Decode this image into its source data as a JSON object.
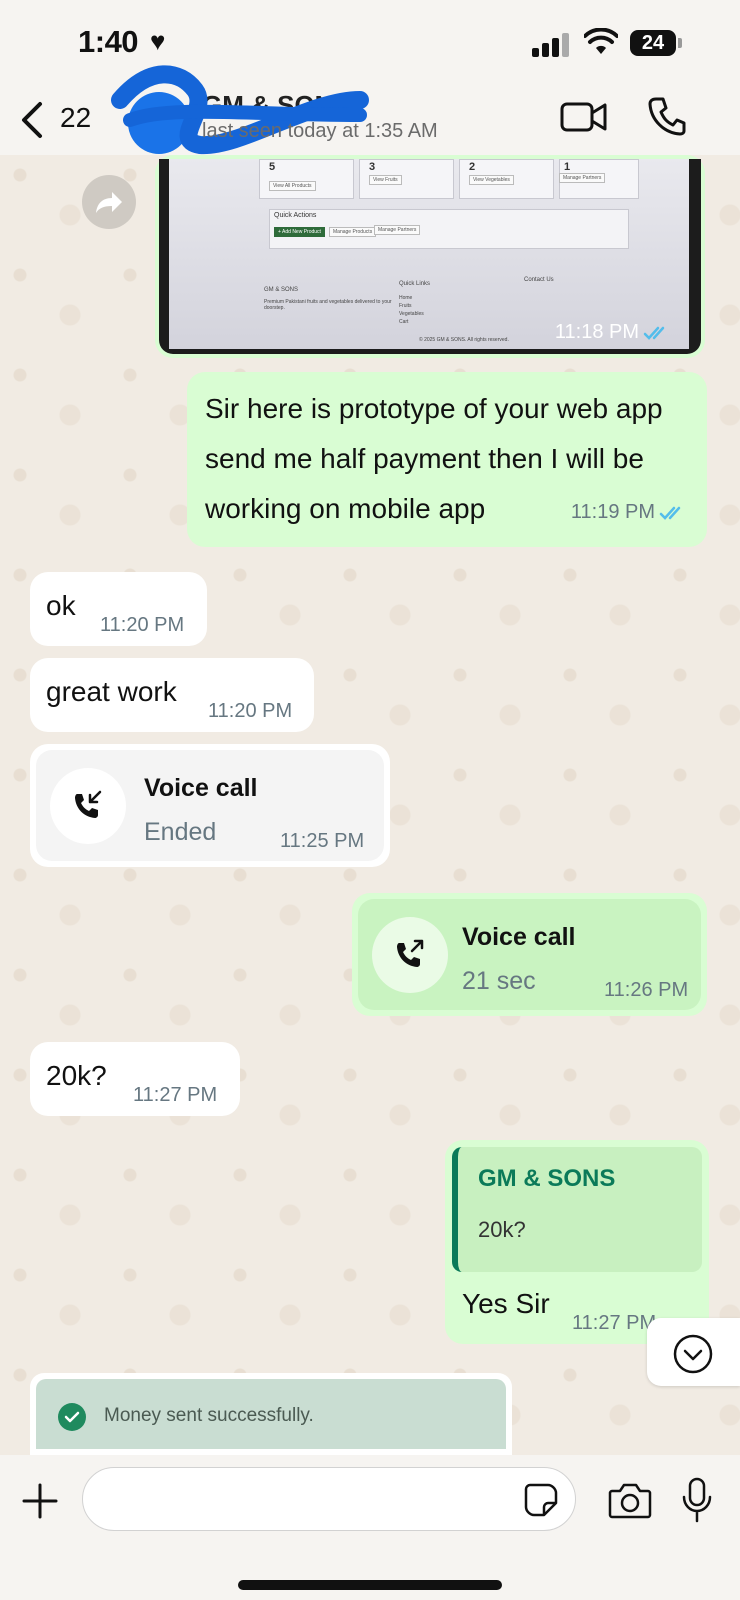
{
  "status_bar": {
    "time": "1:40",
    "battery": "24"
  },
  "header": {
    "unread_count": "22",
    "contact_name": "GM & SONS",
    "last_seen": "last seen today at 1:35 AM",
    "video_icon": "video-camera-icon",
    "call_icon": "phone-icon"
  },
  "messages": {
    "image": {
      "time": "11:18 PM",
      "screen": {
        "stats": [
          "5",
          "3",
          "2",
          "1"
        ],
        "stat_buttons": [
          "View All Products",
          "View Fruits",
          "View Vegetables",
          "Manage Partners"
        ],
        "quick_actions_title": "Quick Actions",
        "actions": [
          "+ Add New Product",
          "Manage Products",
          "Manage Partners"
        ],
        "footer_brand": "GM & SONS",
        "footer_tagline": "Premium Pakistani fruits and vegetables delivered to your doorstep.",
        "quick_links_title": "Quick Links",
        "quick_links": [
          "Home",
          "Fruits",
          "Vegetables",
          "Cart"
        ],
        "contact_title": "Contact Us",
        "copyright": "© 2025 GM & SONS. All rights reserved."
      }
    },
    "prototype": {
      "text": "Sir here is prototype of your web app send me half payment then I will be working on mobile app",
      "time": "11:19 PM"
    },
    "ok": {
      "text": "ok",
      "time": "11:20 PM"
    },
    "great": {
      "text": "great work",
      "time": "11:20 PM"
    },
    "call_in": {
      "title": "Voice call",
      "status": "Ended",
      "time": "11:25 PM"
    },
    "call_out": {
      "title": "Voice call",
      "duration": "21 sec",
      "time": "11:26 PM"
    },
    "price": {
      "text": "20k?",
      "time": "11:27 PM"
    },
    "reply": {
      "quote_name": "GM & SONS",
      "quote_text": "20k?",
      "text": "Yes Sir",
      "time": "11:27 PM"
    },
    "money_notice": {
      "text": "Money sent successfully."
    }
  },
  "input": {
    "placeholder": ""
  },
  "colors": {
    "outgoing": "#d9fdd3",
    "incoming": "#ffffff",
    "tick_blue": "#53bdeb",
    "brand_green": "#0b7a59"
  }
}
